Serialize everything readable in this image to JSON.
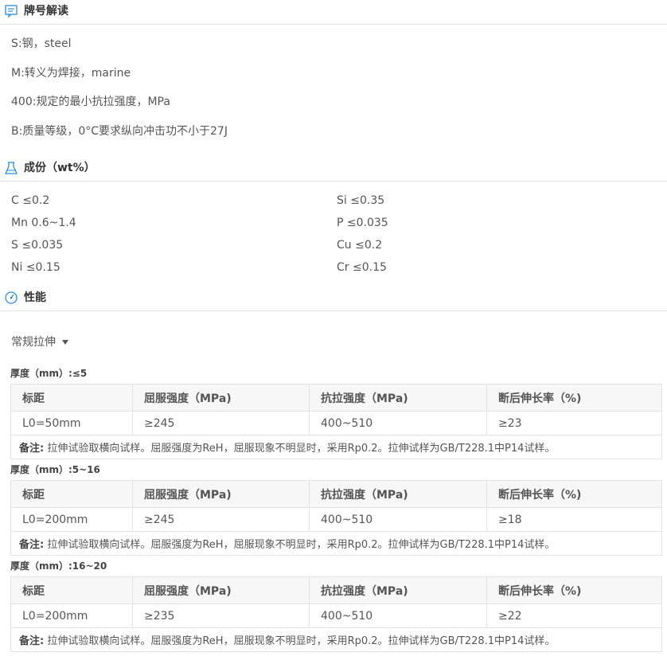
{
  "brand": {
    "title": "牌号解读",
    "lines": [
      "S:钢，steel",
      "M:转义为焊接，marine",
      "400:规定的最小抗拉强度，MPa",
      "B:质量等级，0°C要求纵向冲击功不小于27J"
    ]
  },
  "composition": {
    "title": "成份（wt%）",
    "items": [
      {
        "el": "C",
        "val": "≤0.2"
      },
      {
        "el": "Si",
        "val": "≤0.35"
      },
      {
        "el": "Mn",
        "val": "0.6~1.4"
      },
      {
        "el": "P",
        "val": "≤0.035"
      },
      {
        "el": "S",
        "val": "≤0.035"
      },
      {
        "el": "Cu",
        "val": "≤0.2"
      },
      {
        "el": "Ni",
        "val": "≤0.15"
      },
      {
        "el": "Cr",
        "val": "≤0.15"
      }
    ]
  },
  "performance": {
    "title": "性能",
    "dropdown": "常规拉伸",
    "headers": [
      "标距",
      "屈服强度（MPa)",
      "抗拉强度（MPa)",
      "断后伸长率（%)"
    ],
    "note_label": "备注:",
    "groups": [
      {
        "thickness": "厚度（mm）:≤5",
        "row": [
          "L0=50mm",
          "≥245",
          "400~510",
          "≥23"
        ],
        "note": "拉伸试验取横向试样。屈服强度为ReH，屈服现象不明显时，采用Rp0.2。拉伸试样为GB/T228.1中P14试样。"
      },
      {
        "thickness": "厚度（mm）:5~16",
        "row": [
          "L0=200mm",
          "≥245",
          "400~510",
          "≥18"
        ],
        "note": "拉伸试验取横向试样。屈服强度为ReH，屈服现象不明显时，采用Rp0.2。拉伸试样为GB/T228.1中P14试样。"
      },
      {
        "thickness": "厚度（mm）:16~20",
        "row": [
          "L0=200mm",
          "≥235",
          "400~510",
          "≥22"
        ],
        "note": "拉伸试验取横向试样。屈服强度为ReH，屈服现象不明显时，采用Rp0.2。拉伸试样为GB/T228.1中P14试样。"
      }
    ]
  },
  "icons": {
    "brand": "message-box-icon",
    "composition": "flask-icon",
    "performance": "gauge-icon"
  },
  "colors": {
    "accent": "#2b8fd8",
    "text": "#555555",
    "border": "#e3e3e3",
    "header_bg": "#f7f7f7"
  }
}
